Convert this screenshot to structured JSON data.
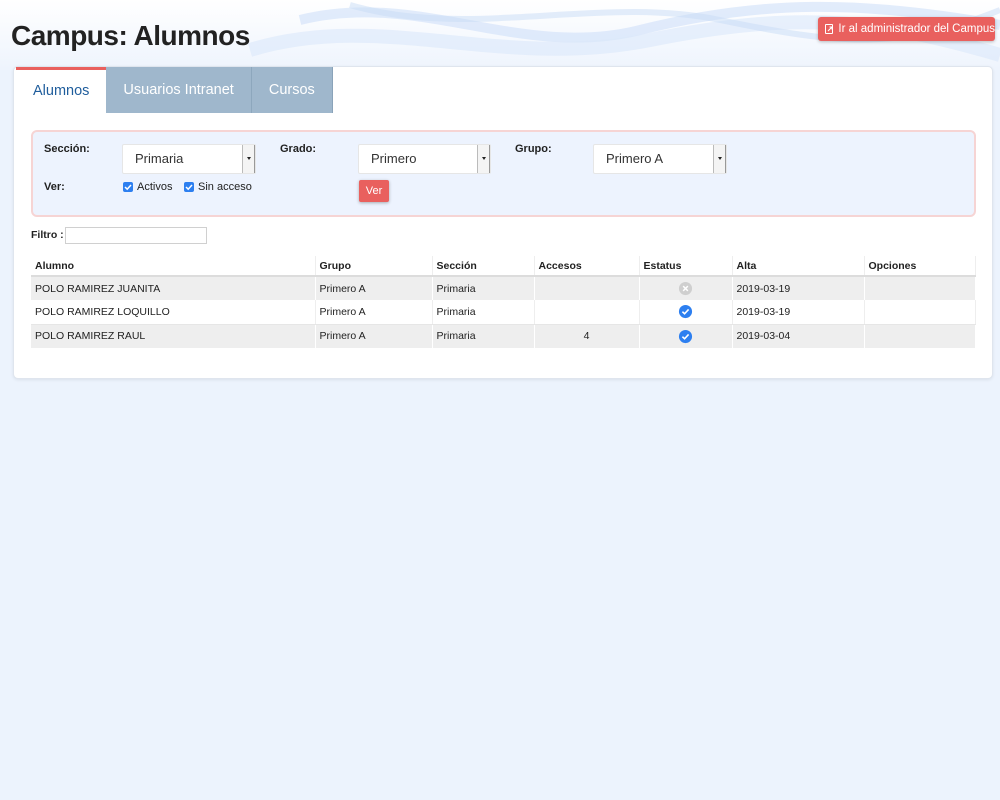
{
  "page": {
    "title": "Campus: Alumnos"
  },
  "header": {
    "admin_button_label": "Ir al administrador del Campus"
  },
  "tabs": [
    {
      "label": "Alumnos",
      "active": true
    },
    {
      "label": "Usuarios Intranet",
      "active": false
    },
    {
      "label": "Cursos",
      "active": false
    }
  ],
  "filters": {
    "seccion_label": "Sección:",
    "seccion_value": "Primaria",
    "grado_label": "Grado:",
    "grado_value": "Primero",
    "grupo_label": "Grupo:",
    "grupo_value": "Primero A",
    "ver_label": "Ver:",
    "activos_label": "Activos",
    "activos_checked": true,
    "sin_acceso_label": "Sin acceso",
    "sin_acceso_checked": true,
    "ver_button_label": "Ver"
  },
  "filtro": {
    "label": "Filtro :",
    "value": ""
  },
  "table": {
    "columns": [
      "Alumno",
      "Grupo",
      "Sección",
      "Accesos",
      "Estatus",
      "Alta",
      "Opciones"
    ],
    "rows": [
      {
        "alumno": "POLO RAMIREZ JUANITA",
        "grupo": "Primero A",
        "seccion": "Primaria",
        "accesos": "",
        "estatus": "x-circle-icon",
        "alta": "2019-03-19",
        "opciones": ""
      },
      {
        "alumno": "POLO RAMIREZ LOQUILLO",
        "grupo": "Primero A",
        "seccion": "Primaria",
        "accesos": "",
        "estatus": "check-circle-icon",
        "alta": "2019-03-19",
        "opciones": ""
      },
      {
        "alumno": "POLO RAMIREZ RAUL",
        "grupo": "Primero A",
        "seccion": "Primaria",
        "accesos": "4",
        "estatus": "check-circle-icon",
        "alta": "2019-03-04",
        "opciones": ""
      }
    ]
  },
  "colors": {
    "accent": "#e9605e",
    "check_blue": "#2d7ff0",
    "tab_inactive": "#9fb7cc",
    "page_bg": "#ecf3fd"
  }
}
